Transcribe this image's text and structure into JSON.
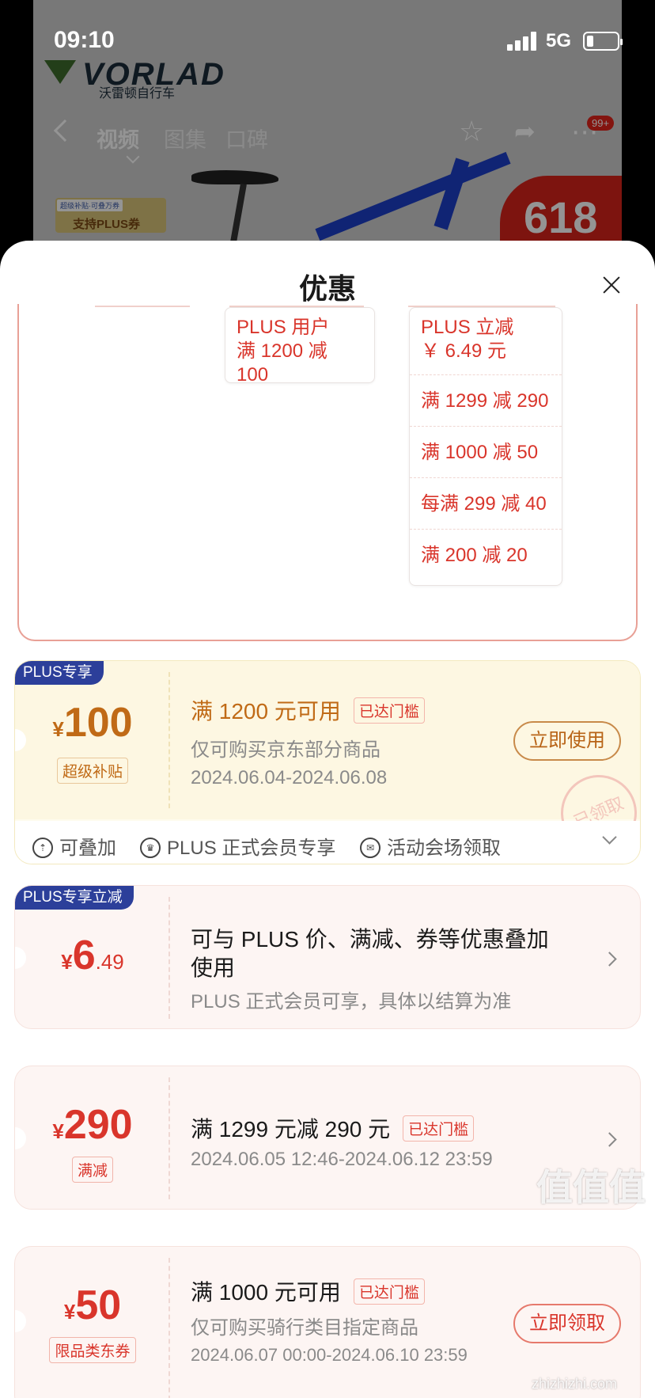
{
  "status_bar": {
    "time": "09:10",
    "network": "5G",
    "battery_level": 0.2
  },
  "background_page": {
    "brand_logo": "VORLAD",
    "brand_name": "沃雷顿自行车",
    "tabs": [
      "视频",
      "图集",
      "口碑"
    ],
    "cart_badge": "99+",
    "promo_618": "618",
    "plus_tag_small": "超级补贴·可叠万券",
    "plus_tag_label": "支持PLUS券"
  },
  "sheet": {
    "title": "优惠"
  },
  "stack_summary": {
    "col1": [
      "PLUS 用户",
      "满 1200 减 100"
    ],
    "col2_head": [
      "PLUS 立减",
      "￥ 6.49 元"
    ],
    "col2_rows": [
      "满 1299 减 290",
      "满 1000 减 50",
      "每满 299 减 40",
      "满 200 减 20"
    ]
  },
  "coupons": {
    "plus": {
      "corner_tag": "PLUS专享",
      "currency": "¥",
      "amount": "100",
      "type_tag": "超级补贴",
      "title": "满 1200 元可用",
      "threshold": "已达门槛",
      "desc": "仅可购买京东部分商品",
      "date": "2024.06.04-2024.06.08",
      "button": "立即使用",
      "stamp": "已领取",
      "footer": [
        "可叠加",
        "PLUS 正式会员专享",
        "活动会场领取"
      ]
    },
    "plus_discount": {
      "corner_tag": "PLUS专享立减",
      "currency": "¥",
      "amount_int": "6",
      "amount_dec": ".49",
      "title_line1": "可与 PLUS 价、满减、券等优惠叠加",
      "title_line2": "使用",
      "desc": "PLUS 正式会员可享，具体以结算为准"
    },
    "full_reduction": {
      "currency": "¥",
      "amount": "290",
      "type_tag": "满减",
      "title": "满 1299 元减 290 元",
      "threshold": "已达门槛",
      "date": "2024.06.05 12:46-2024.06.12 23:59"
    },
    "category": {
      "currency": "¥",
      "amount": "50",
      "type_tag": "限品类东券",
      "title": "满 1000 元可用",
      "threshold": "已达门槛",
      "desc": "仅可购买骑行类目指定商品",
      "date": "2024.06.07 00:00-2024.06.10 23:59",
      "button": "立即领取"
    }
  },
  "watermark": {
    "logo": "值值值",
    "url": "zhizhizhi.com"
  },
  "colors": {
    "accent_red": "#d9352b",
    "plus_gold": "#c06a16",
    "plus_navy": "#2c3f9a"
  }
}
